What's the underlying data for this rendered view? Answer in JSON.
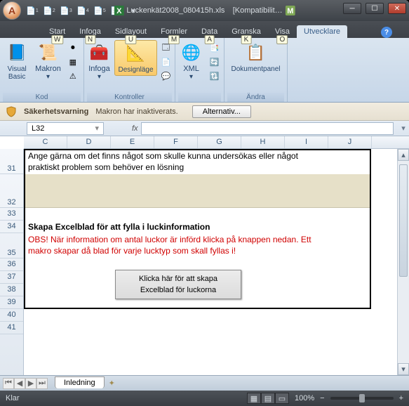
{
  "title": {
    "filename": "Luckenkät2008_080415h.xls",
    "compat": "[Kompatibilit…"
  },
  "tabs": [
    {
      "label": "Start",
      "key": "W"
    },
    {
      "label": "Infoga",
      "key": "N"
    },
    {
      "label": "Sidlayout",
      "key": "U"
    },
    {
      "label": "Formler",
      "key": "M"
    },
    {
      "label": "Data",
      "key": "A"
    },
    {
      "label": "Granska",
      "key": "K"
    },
    {
      "label": "Visa",
      "key": "O"
    },
    {
      "label": "Utvecklare",
      "key": ""
    }
  ],
  "ribbon": {
    "groups": {
      "kod": {
        "label": "Kod",
        "visual_basic": "Visual\nBasic",
        "makron": "Makron"
      },
      "kontroller": {
        "label": "Kontroller",
        "infoga": "Infoga",
        "designlage": "Designläge"
      },
      "xml": {
        "label": "",
        "xml": "XML"
      },
      "andra": {
        "label": "Ändra",
        "dokumentpanel": "Dokumentpanel"
      }
    }
  },
  "security": {
    "title": "Säkerhetsvarning",
    "msg": "Makron har inaktiverats.",
    "btn": "Alternativ..."
  },
  "namebox": "L32",
  "columns": [
    "C",
    "D",
    "E",
    "F",
    "G",
    "H",
    "I",
    "J"
  ],
  "rows": [
    "31",
    "32",
    "33",
    "34",
    "35",
    "36",
    "37",
    "38",
    "39",
    "40",
    "41"
  ],
  "content": {
    "r31a": "Ange gärna om det finns något som skulle kunna undersökas eller något",
    "r31b": "praktiskt problem som behöver en lösning",
    "r34": "Skapa Excelblad för att fylla i luckinformation",
    "r35a": "OBS! När information om antal luckor är införd klicka på knappen nedan. Ett",
    "r35b": "makro skapar då blad för varje lucktyp som skall fyllas i!",
    "button_l1": "Klicka här för att skapa",
    "button_l2": "Excelblad för luckorna"
  },
  "sheet_tab": "Inledning",
  "status": {
    "ready": "Klar",
    "zoom": "100%"
  }
}
